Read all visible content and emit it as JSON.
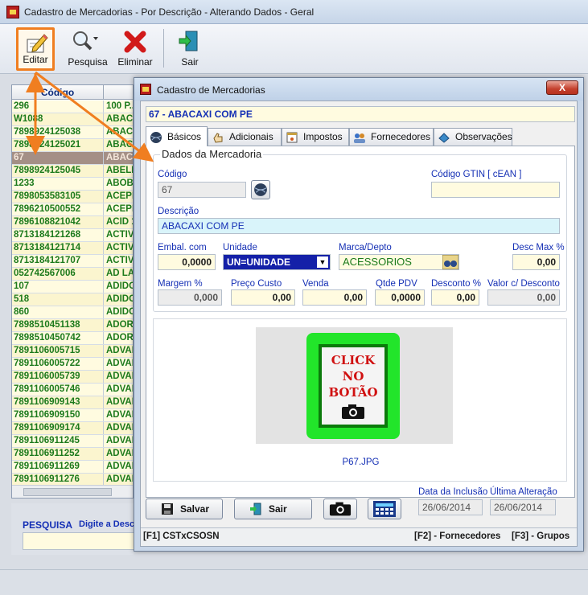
{
  "window": {
    "title": "Cadastro de Mercadorias - Por Descrição - Alterando Dados - Geral"
  },
  "toolbar": {
    "editar": "Editar",
    "pesquisa": "Pesquisa",
    "eliminar": "Eliminar",
    "sair": "Sair"
  },
  "grid": {
    "col_codigo": "Código",
    "rows": [
      {
        "codigo": "296",
        "desc": "100 P..."
      },
      {
        "codigo": "W1088",
        "desc": "ABAC"
      },
      {
        "codigo": "7898924125038",
        "desc": "ABAC"
      },
      {
        "codigo": "7898924125021",
        "desc": "ABAC"
      },
      {
        "codigo": "67",
        "desc": "ABAC"
      },
      {
        "codigo": "7898924125045",
        "desc": "ABELH"
      },
      {
        "codigo": "1233",
        "desc": "ABOBO"
      },
      {
        "codigo": "7898053583105",
        "desc": "ACEPR"
      },
      {
        "codigo": "7896210500552",
        "desc": "ACEPR"
      },
      {
        "codigo": "7896108821042",
        "desc": "ACID 1"
      },
      {
        "codigo": "8713184121268",
        "desc": "ACTIV"
      },
      {
        "codigo": "8713184121714",
        "desc": "ACTIV"
      },
      {
        "codigo": "8713184121707",
        "desc": "ACTIV"
      },
      {
        "codigo": "052742567006",
        "desc": "AD LA"
      },
      {
        "codigo": "107",
        "desc": "ADIDO"
      },
      {
        "codigo": "518",
        "desc": "ADIDO"
      },
      {
        "codigo": "860",
        "desc": "ADIDO"
      },
      {
        "codigo": "7898510451138",
        "desc": "ADOR"
      },
      {
        "codigo": "7898510450742",
        "desc": "ADOR"
      },
      {
        "codigo": "7891106005715",
        "desc": "ADVAN"
      },
      {
        "codigo": "7891106005722",
        "desc": "ADVAN"
      },
      {
        "codigo": "7891106005739",
        "desc": "ADVAN"
      },
      {
        "codigo": "7891106005746",
        "desc": "ADVAN"
      },
      {
        "codigo": "7891106909143",
        "desc": "ADVAN"
      },
      {
        "codigo": "7891106909150",
        "desc": "ADVAN"
      },
      {
        "codigo": "7891106909174",
        "desc": "ADVAN"
      },
      {
        "codigo": "7891106911245",
        "desc": "ADVAN"
      },
      {
        "codigo": "7891106911252",
        "desc": "ADVAN"
      },
      {
        "codigo": "7891106911269",
        "desc": "ADVAN"
      },
      {
        "codigo": "7891106911276",
        "desc": "ADVAN"
      }
    ],
    "selected_index": 4
  },
  "search": {
    "label": "PESQUISA",
    "hint": "Digite a Desc"
  },
  "dialog": {
    "title": "Cadastro de Mercadorias",
    "close": "X",
    "header_value": "67 - ABACAXI COM PE",
    "tabs": [
      "Básicos",
      "Adicionais",
      "Impostos",
      "Fornecedores",
      "Observações"
    ],
    "group_title": "Dados da Mercadoria",
    "fields": {
      "codigo_label": "Código",
      "codigo_value": "67",
      "gtin_label": "Código GTIN [ cEAN ]",
      "gtin_value": "",
      "descricao_label": "Descrição",
      "descricao_value": "ABACAXI COM PE",
      "embal_label": "Embal. com",
      "embal_value": "0,0000",
      "unidade_label": "Unidade",
      "unidade_value": "UN=UNIDADE",
      "marca_label": "Marca/Depto",
      "marca_value": "ACESSORIOS",
      "descmax_label": "Desc Max %",
      "descmax_value": "0,00",
      "margem_label": "Margem %",
      "margem_value": "0,000",
      "custo_label": "Preço Custo",
      "custo_value": "0,00",
      "venda_label": "Venda",
      "venda_value": "0,00",
      "qtde_label": "Qtde PDV",
      "qtde_value": "0,0000",
      "desconto_label": "Desconto %",
      "desconto_value": "0,00",
      "valordesc_label": "Valor c/ Desconto",
      "valordesc_value": "0,00"
    },
    "image": {
      "line1": "CLICK",
      "line2": "NO",
      "line3": "BOTÃO",
      "caption": "P67.JPG"
    },
    "buttons": {
      "salvar": "Salvar",
      "sair": "Sair"
    },
    "dates": {
      "inclusao_label": "Data da Inclusão",
      "inclusao_value": "26/06/2014",
      "alteracao_label": "Última Alteração",
      "alteracao_value": "26/06/2014"
    },
    "footer": {
      "f1": "[F1] CSTxCSOSN",
      "f2": "[F2] - Fornecedores",
      "f3": "[F3] - Grupos"
    }
  },
  "colors": {
    "accent_orange": "#f07e20",
    "grid_text_green": "#1c7a1c",
    "label_blue": "#1530b5"
  }
}
